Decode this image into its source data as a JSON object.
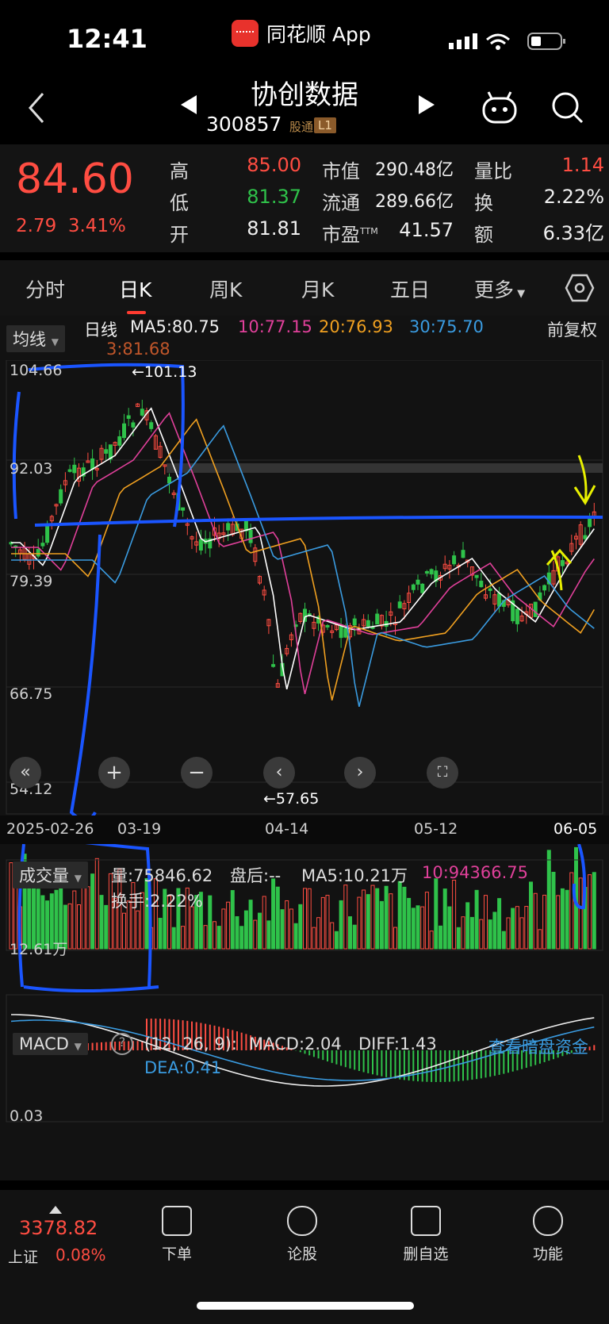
{
  "status_bar": {
    "time": "12:41",
    "app_name": "同花顺 App"
  },
  "header": {
    "title": "协创数据",
    "code": "300857",
    "tag_connect": "股通",
    "tag_level": "L1"
  },
  "quote": {
    "price": "84.60",
    "change": "2.79",
    "change_pct": "3.41%",
    "high_label": "高",
    "high": "85.00",
    "low_label": "低",
    "low": "81.37",
    "open_label": "开",
    "open": "81.81",
    "mcap_label": "市值",
    "mcap": "290.48亿",
    "float_label": "流通",
    "float": "289.66亿",
    "pe_label": "市盈",
    "pe_sup": "TTM",
    "pe": "41.57",
    "vol_ratio_label": "量比",
    "vol_ratio": "1.14",
    "turnover_label": "换",
    "turnover": "2.22%",
    "amount_label": "额",
    "amount": "6.33亿"
  },
  "tabs": [
    "分时",
    "日K",
    "周K",
    "月K",
    "五日",
    "更多"
  ],
  "indicator": {
    "selector": "均线",
    "period": "日线",
    "ma5": "MA5:80.75",
    "ma10": "10:77.15",
    "ma20": "20:76.93",
    "ma30": "30:75.70",
    "ma3": "3:81.68",
    "adjust": "前复权"
  },
  "price_axis": {
    "top": "104.66",
    "p2": "92.03",
    "p3": "79.39",
    "p4": "66.75",
    "bottom": "54.12"
  },
  "annotations": {
    "high_mark": "←101.13",
    "low_mark": "←57.65"
  },
  "dates": [
    "2025-02-26",
    "03-19",
    "04-14",
    "05-12",
    "06-05"
  ],
  "volume": {
    "selector": "成交量",
    "vol": "量:75846.62",
    "after": "盘后:--",
    "ma5": "MA5:10.21万",
    "ma10": "10:94366.75",
    "turnover": "换手:2.22%",
    "axis": "12.61万"
  },
  "macd": {
    "selector": "MACD",
    "params": "(12, 26, 9):",
    "macd": "MACD:2.04",
    "diff": "DIFF:1.43",
    "dea": "DEA:0.41",
    "link": "查看暗盘资金",
    "axis": "0.03"
  },
  "bottom": {
    "index_value": "3378.82",
    "index_name": "上证",
    "index_pct": "0.08%",
    "nav": [
      "下单",
      "论股",
      "删自选",
      "功能"
    ]
  },
  "colors": {
    "up": "#ff4d42",
    "down": "#2fc24a",
    "ma5": "#ffffff",
    "ma10": "#e0409a",
    "ma20": "#f0a020",
    "ma30": "#3a9be0",
    "bg": "#121212"
  }
}
